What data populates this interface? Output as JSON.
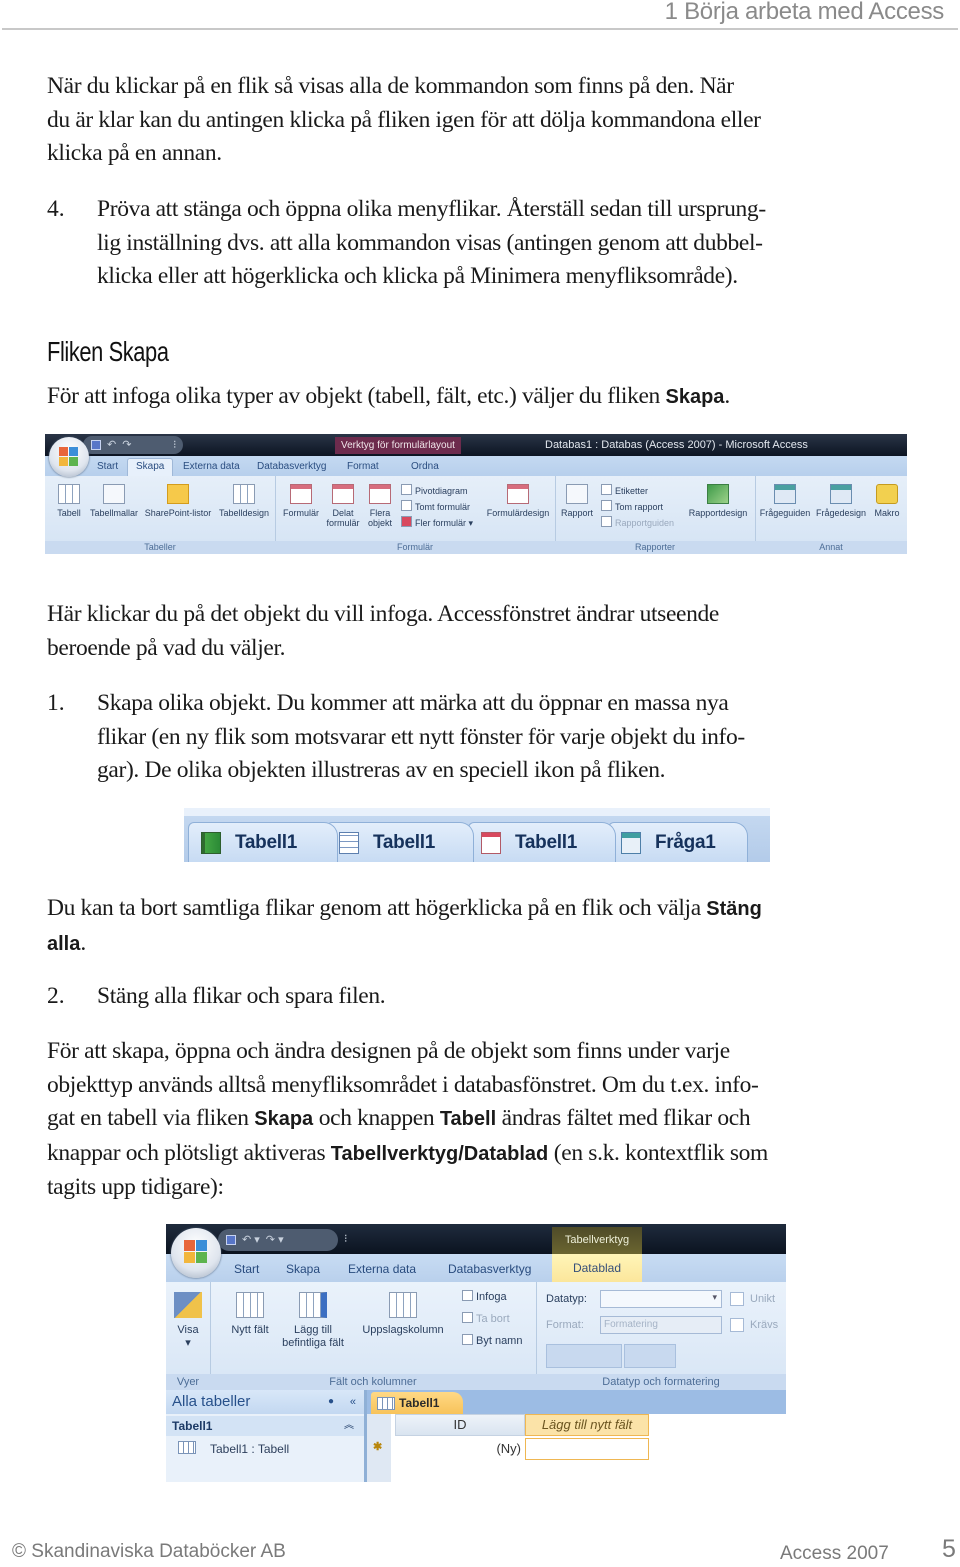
{
  "header": {
    "chapter_title": "1 Börja arbeta med Access"
  },
  "intro": {
    "paragraph": "När du klickar på en flik så visas alla de kommandon som finns på den. När du är klar kan du antingen klicka på fliken igen för att dölja kommandona eller klicka på en annan.",
    "lines": [
      "När du klickar på en flik så visas alla de kommandon som finns på den. När",
      "du är klar kan du antingen klicka på fliken igen för att dölja kommandona eller",
      "klicka på en annan."
    ]
  },
  "step4": {
    "number": "4.",
    "lines": [
      "Pröva att stänga och öppna olika menyflikar. Återställ sedan till ursprung-",
      "lig inställning dvs. att alla kommandon visas (antingen genom att dubbel-",
      "klicka eller att högerklicka och klicka på Minimera menyfliksområde)."
    ]
  },
  "section": {
    "heading": "Fliken Skapa",
    "lead_text": "För att infoga olika typer av objekt (tabell, fält, etc.) väljer du fliken ",
    "lead_bold": "Skapa",
    "lead_end": "."
  },
  "ribbon1": {
    "contextual_title": "Verktyg för formulärlayout",
    "app_title": "Databas1 : Databas (Access 2007) - Microsoft Access",
    "tabs": [
      "Start",
      "Skapa",
      "Externa data",
      "Databasverktyg",
      "Format",
      "Ordna"
    ],
    "active_tab": "Skapa",
    "groups": {
      "tabeller": {
        "label": "Tabeller",
        "buttons": [
          "Tabell",
          "Tabellmallar",
          "SharePoint-listor",
          "Tabelldesign"
        ]
      },
      "formular": {
        "label": "Formulär",
        "buttons": [
          "Formulär",
          "Delat formulär",
          "Flera objekt",
          "Formulärdesign"
        ],
        "small": [
          "Pivotdiagram",
          "Tomt formulär",
          "Fler formulär"
        ]
      },
      "rapporter": {
        "label": "Rapporter",
        "buttons": [
          "Rapport",
          "Rapportdesign"
        ],
        "small": [
          "Etiketter",
          "Tom rapport",
          "Rapportguiden"
        ]
      },
      "annat": {
        "label": "Annat",
        "buttons": [
          "Frågeguiden",
          "Frågedesign",
          "Makro"
        ]
      }
    }
  },
  "after_ribbon": {
    "lines": [
      "Här klickar du på det objekt du vill infoga. Accessfönstret ändrar utseende",
      "beroende på vad du väljer."
    ]
  },
  "step1": {
    "number": "1.",
    "lines": [
      "Skapa olika objekt. Du kommer att märka att du öppnar en massa nya",
      "flikar (en ny flik som motsvarar ett nytt fönster för varje objekt du info-",
      "gar). De olika objekten illustreras av en speciell ikon på fliken."
    ]
  },
  "document_tabs": [
    {
      "label": "Tabell1",
      "icon": "report-icon"
    },
    {
      "label": "Tabell1",
      "icon": "table-icon"
    },
    {
      "label": "Tabell1",
      "icon": "form-icon"
    },
    {
      "label": "Fråga1",
      "icon": "query-icon"
    }
  ],
  "close_all": {
    "text": "Du kan ta bort samtliga flikar genom att högerklicka på en flik och välja ",
    "bold_1": "Stäng",
    "bold_2": "alla",
    "end": "."
  },
  "step2": {
    "number": "2.",
    "text": "Stäng alla flikar och spara filen."
  },
  "design_para": {
    "line1": "För att skapa, öppna och ändra designen på de objekt som finns under varje",
    "line2": "objekttyp används alltså menyfliksområdet i databasfönstret. Om du t.ex. info-",
    "line3_a": "gat en tabell via fliken ",
    "line3_b": "Skapa",
    "line3_c": " och knappen ",
    "line3_d": "Tabell",
    "line3_e": " ändras fältet med flikar och",
    "line4_a": "knappar och plötsligt aktiveras ",
    "line4_b": "Tabellverktyg/Datablad",
    "line4_c": " (en s.k. kontextflik som",
    "line5": "tagits upp tidigare):"
  },
  "ribbon2": {
    "contextual_title": "Tabellverktyg",
    "tabs": [
      "Start",
      "Skapa",
      "Externa data",
      "Databasverktyg"
    ],
    "active_tab": "Datablad",
    "groups": {
      "vyer": {
        "label": "Vyer",
        "buttons": [
          "Visa"
        ]
      },
      "falt": {
        "label": "Fält och kolumner",
        "buttons": [
          "Nytt fält",
          "Lägg till befintliga fält",
          "Uppslagskolumn"
        ],
        "small": [
          "Infoga",
          "Ta bort",
          "Byt namn"
        ]
      },
      "datatyp": {
        "label": "Datatyp och formatering",
        "datatyp_label": "Datatyp:",
        "datatyp_value": "",
        "format_label": "Format:",
        "format_placeholder": "Formatering",
        "checkboxes": [
          "Unikt",
          "Krävs"
        ]
      }
    },
    "nav_pane": {
      "title": "Alla tabeller",
      "group": "Tabell1",
      "item": "Tabell1 : Tabell"
    },
    "sheet": {
      "tab_label": "Tabell1",
      "columns": [
        "ID",
        "Lägg till nytt fält"
      ],
      "new_row_value": "(Ny)"
    }
  },
  "footer": {
    "publisher": "© Skandinaviska Databöcker AB",
    "book": "Access 2007",
    "page": "5"
  }
}
